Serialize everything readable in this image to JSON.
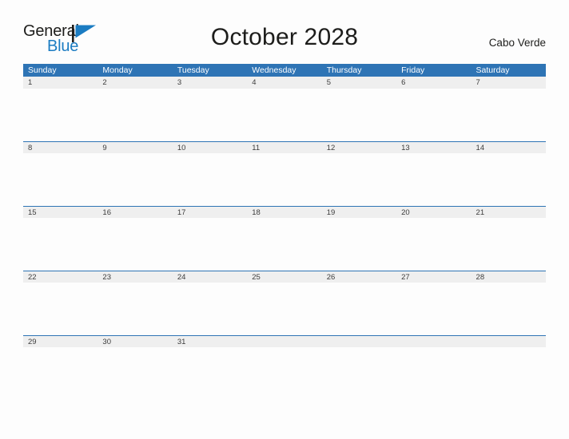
{
  "brand": {
    "name_top": "General",
    "name_bottom": "Blue",
    "flag_icon": "flag-triangle-icon",
    "accent_color": "#1b7cc2",
    "text_color": "#1d1d1b"
  },
  "header": {
    "title": "October 2028",
    "location": "Cabo Verde"
  },
  "calendar": {
    "month": "October",
    "year": "2028",
    "header_background": "#2e74b5",
    "date_band_background": "#efefef",
    "weekdays": [
      "Sunday",
      "Monday",
      "Tuesday",
      "Wednesday",
      "Thursday",
      "Friday",
      "Saturday"
    ],
    "weeks": [
      {
        "days": [
          "1",
          "2",
          "3",
          "4",
          "5",
          "6",
          "7"
        ]
      },
      {
        "days": [
          "8",
          "9",
          "10",
          "11",
          "12",
          "13",
          "14"
        ]
      },
      {
        "days": [
          "15",
          "16",
          "17",
          "18",
          "19",
          "20",
          "21"
        ]
      },
      {
        "days": [
          "22",
          "23",
          "24",
          "25",
          "26",
          "27",
          "28"
        ]
      },
      {
        "days": [
          "29",
          "30",
          "31",
          "",
          "",
          "",
          ""
        ]
      }
    ]
  }
}
